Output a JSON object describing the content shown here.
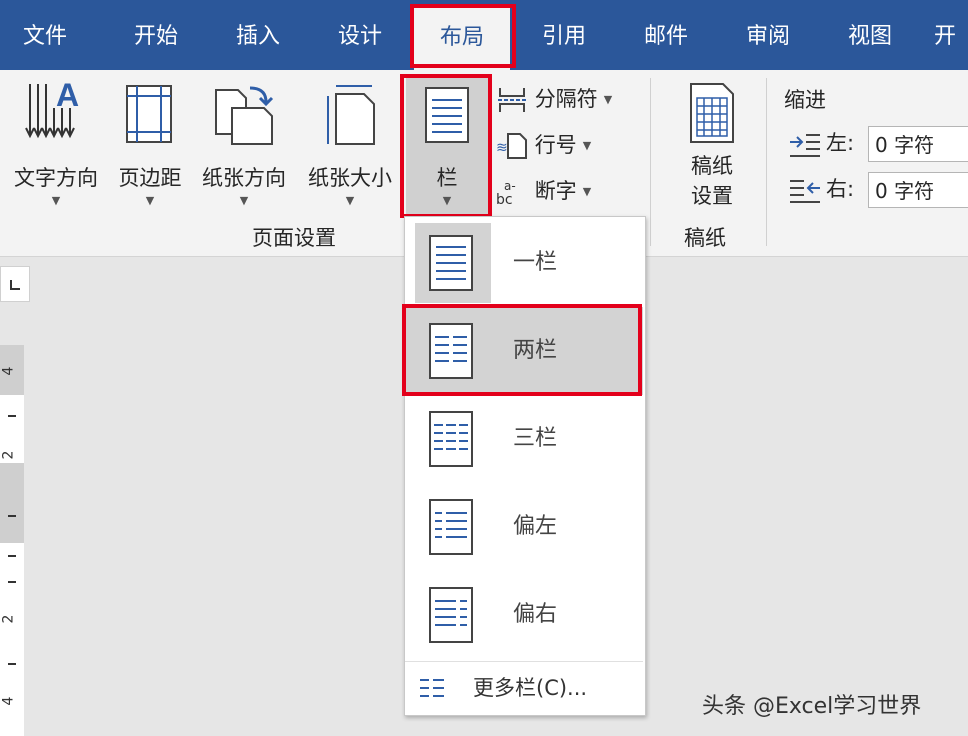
{
  "tabs": [
    "文件",
    "开始",
    "插入",
    "设计",
    "布局",
    "引用",
    "邮件",
    "审阅",
    "视图",
    "开"
  ],
  "ribbon": {
    "text_direction": "文字方向",
    "margins": "页边距",
    "orientation": "纸张方向",
    "size": "纸张大小",
    "columns": "栏",
    "breaks": "分隔符",
    "line_numbers": "行号",
    "hyphenation": "断字",
    "page_setup_group": "页面设置",
    "draft_paper_line1": "稿纸",
    "draft_paper_line2": "设置",
    "draft_paper_group": "稿纸",
    "indent_title": "缩进",
    "indent_left_label": "左:",
    "indent_left_value": "0 字符",
    "indent_right_label": "右:",
    "indent_right_value": "0 字符"
  },
  "ruler": {
    "numbers": [
      "4",
      "2",
      "2",
      "4"
    ]
  },
  "columns_menu": {
    "items": [
      "一栏",
      "两栏",
      "三栏",
      "偏左",
      "偏右"
    ],
    "more": "更多栏(C)..."
  },
  "watermark": "头条 @Excel学习世界",
  "colors": {
    "accent": "#2b579a",
    "highlight": "#e3001b",
    "icon_blue": "#2f5ea8"
  }
}
